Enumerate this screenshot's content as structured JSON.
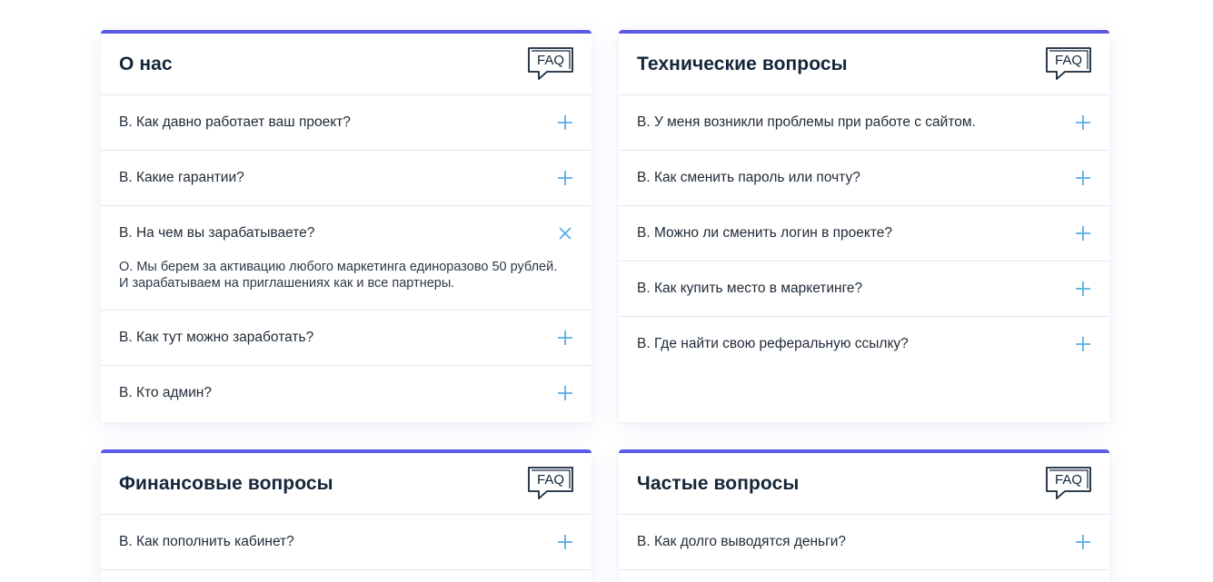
{
  "sections": [
    {
      "title": "О нас",
      "items": [
        {
          "question": "В. Как давно работает ваш проект?",
          "expanded": false
        },
        {
          "question": "В. Какие гарантии?",
          "expanded": false
        },
        {
          "question": "В. На чем вы зарабатываете?",
          "expanded": true,
          "answer_line1": "О. Мы берем за активацию любого маркетинга единоразово 50 рублей.",
          "answer_line2": "И зарабатываем на приглашениях как и все партнеры."
        },
        {
          "question": "В. Как тут можно заработать?",
          "expanded": false
        },
        {
          "question": "В. Кто админ?",
          "expanded": false
        }
      ]
    },
    {
      "title": "Технические вопросы",
      "items": [
        {
          "question": "В. У меня возникли проблемы при работе с сайтом.",
          "expanded": false
        },
        {
          "question": "В. Как сменить пароль или почту?",
          "expanded": false
        },
        {
          "question": "В. Можно ли сменить логин в проекте?",
          "expanded": false
        },
        {
          "question": "В. Как купить место в маркетинге?",
          "expanded": false
        },
        {
          "question": "В. Где найти свою реферальную ссылку?",
          "expanded": false
        }
      ]
    },
    {
      "title": "Финансовые вопросы",
      "items": [
        {
          "question": "В. Как пополнить кабинет?",
          "expanded": false
        }
      ]
    },
    {
      "title": "Частые вопросы",
      "items": [
        {
          "question": "В. Как долго выводятся деньги?",
          "expanded": false
        }
      ]
    }
  ],
  "faq_icon_text": "FAQ",
  "icons": {
    "expand": "plus-icon",
    "collapse": "close-icon",
    "badge": "faq-chat-icon"
  },
  "colors": {
    "accent": "#5a5ce6",
    "toggle": "#5aaee6",
    "title": "#14263a"
  }
}
